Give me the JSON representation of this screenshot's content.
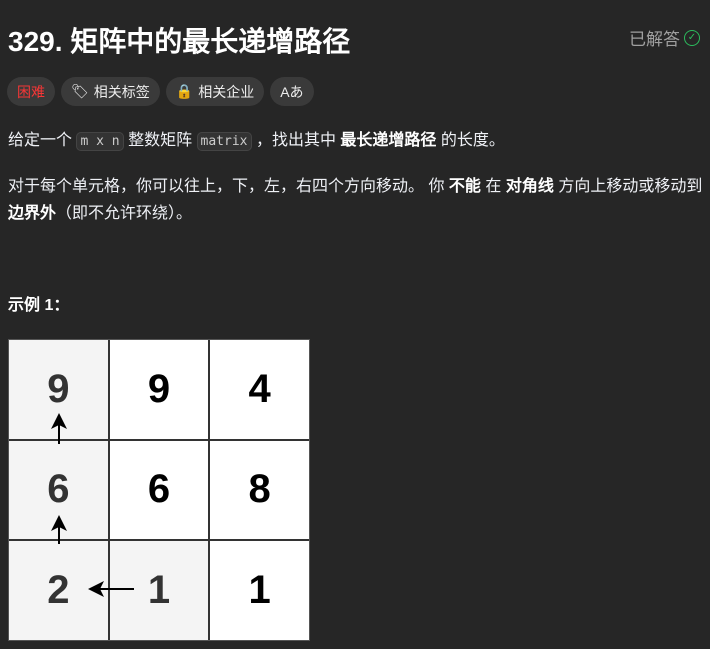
{
  "title": "329. 矩阵中的最长递增路径",
  "status": "已解答",
  "tags": {
    "difficulty": "困难",
    "topics": "相关标签",
    "companies": "相关企业",
    "font": "Aあ"
  },
  "desc": {
    "p1a": "给定一个",
    "p1code1": "m x n",
    "p1b": "整数矩阵",
    "p1code2": "matrix",
    "p1c": "，找出其中",
    "p1bold": "最长递增路径",
    "p1d": "的长度。",
    "p2a": "对于每个单元格，你可以往上，下，左，右四个方向移动。 你",
    "p2b1": "不能",
    "p2c": "在",
    "p2b2": "对角线",
    "p2d": "方向上移动或移动到",
    "p2b3": "边界外",
    "p2e": "（即不允许环绕）。"
  },
  "example_title": "示例 1：",
  "matrix": [
    [
      "9",
      "9",
      "4"
    ],
    [
      "6",
      "6",
      "8"
    ],
    [
      "2",
      "1",
      "1"
    ]
  ],
  "colors": {
    "accent_hard": "#f63636",
    "solved": "#2cbb5d"
  }
}
